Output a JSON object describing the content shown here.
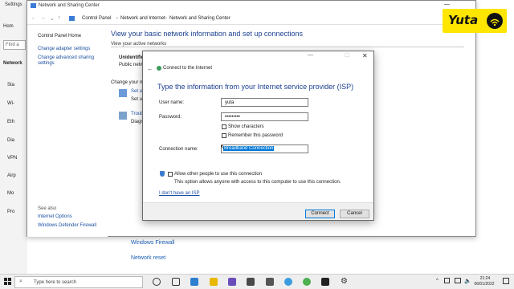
{
  "settings": {
    "title": "Settings",
    "nav": [
      "Hom",
      "Find a",
      "Network",
      "Sta",
      "Wi-",
      "Eth",
      "Dia",
      "VPN",
      "Airp",
      "Mo",
      "Pro"
    ],
    "links": [
      "Windows Firewall",
      "Network reset"
    ]
  },
  "control_panel": {
    "title": "Network and Sharing Center",
    "breadcrumbs": [
      "Control Panel",
      "Network and Internet",
      "Network and Sharing Center"
    ],
    "sidebar": {
      "home": "Control Panel Home",
      "links": [
        "Change adapter settings",
        "Change advanced sharing settings"
      ],
      "see_also_label": "See also",
      "see_also": [
        "Internet Options",
        "Windows Defender Firewall"
      ]
    },
    "main_title": "View your basic network information and set up connections",
    "active_networks": "View your active networks",
    "unidentified": "Unidentifie",
    "public": "Public netw",
    "change_settings": "Change your ne",
    "setup": "Set up",
    "setup2": "Set up",
    "trouble": "Troub",
    "diagnose": "Diagn"
  },
  "dialog": {
    "window_title": "Connect to the Internet",
    "heading": "Type the information from your Internet service provider (ISP)",
    "username_label": "User name:",
    "username_value": "yuta",
    "password_label": "Password:",
    "password_value": "•••••••••",
    "show_chars": "Show characters",
    "remember_pw": "Remember this password",
    "connection_label": "Connection name:",
    "connection_value": "Broadband Connection",
    "allow_others": "Allow other people to use this connection",
    "allow_desc": "This option allows anyone with access to this computer to use this connection.",
    "no_isp": "I don't have an ISP",
    "connect": "Connect",
    "cancel": "Cancel"
  },
  "logo": {
    "text": "Yuta"
  },
  "taskbar": {
    "search_placeholder": "Type here to search",
    "time": "21:24",
    "date": "06/01/2022"
  },
  "colors": {
    "accent": "#0078d7",
    "link": "#1a4fa0",
    "logo_bg": "#ffe600"
  }
}
